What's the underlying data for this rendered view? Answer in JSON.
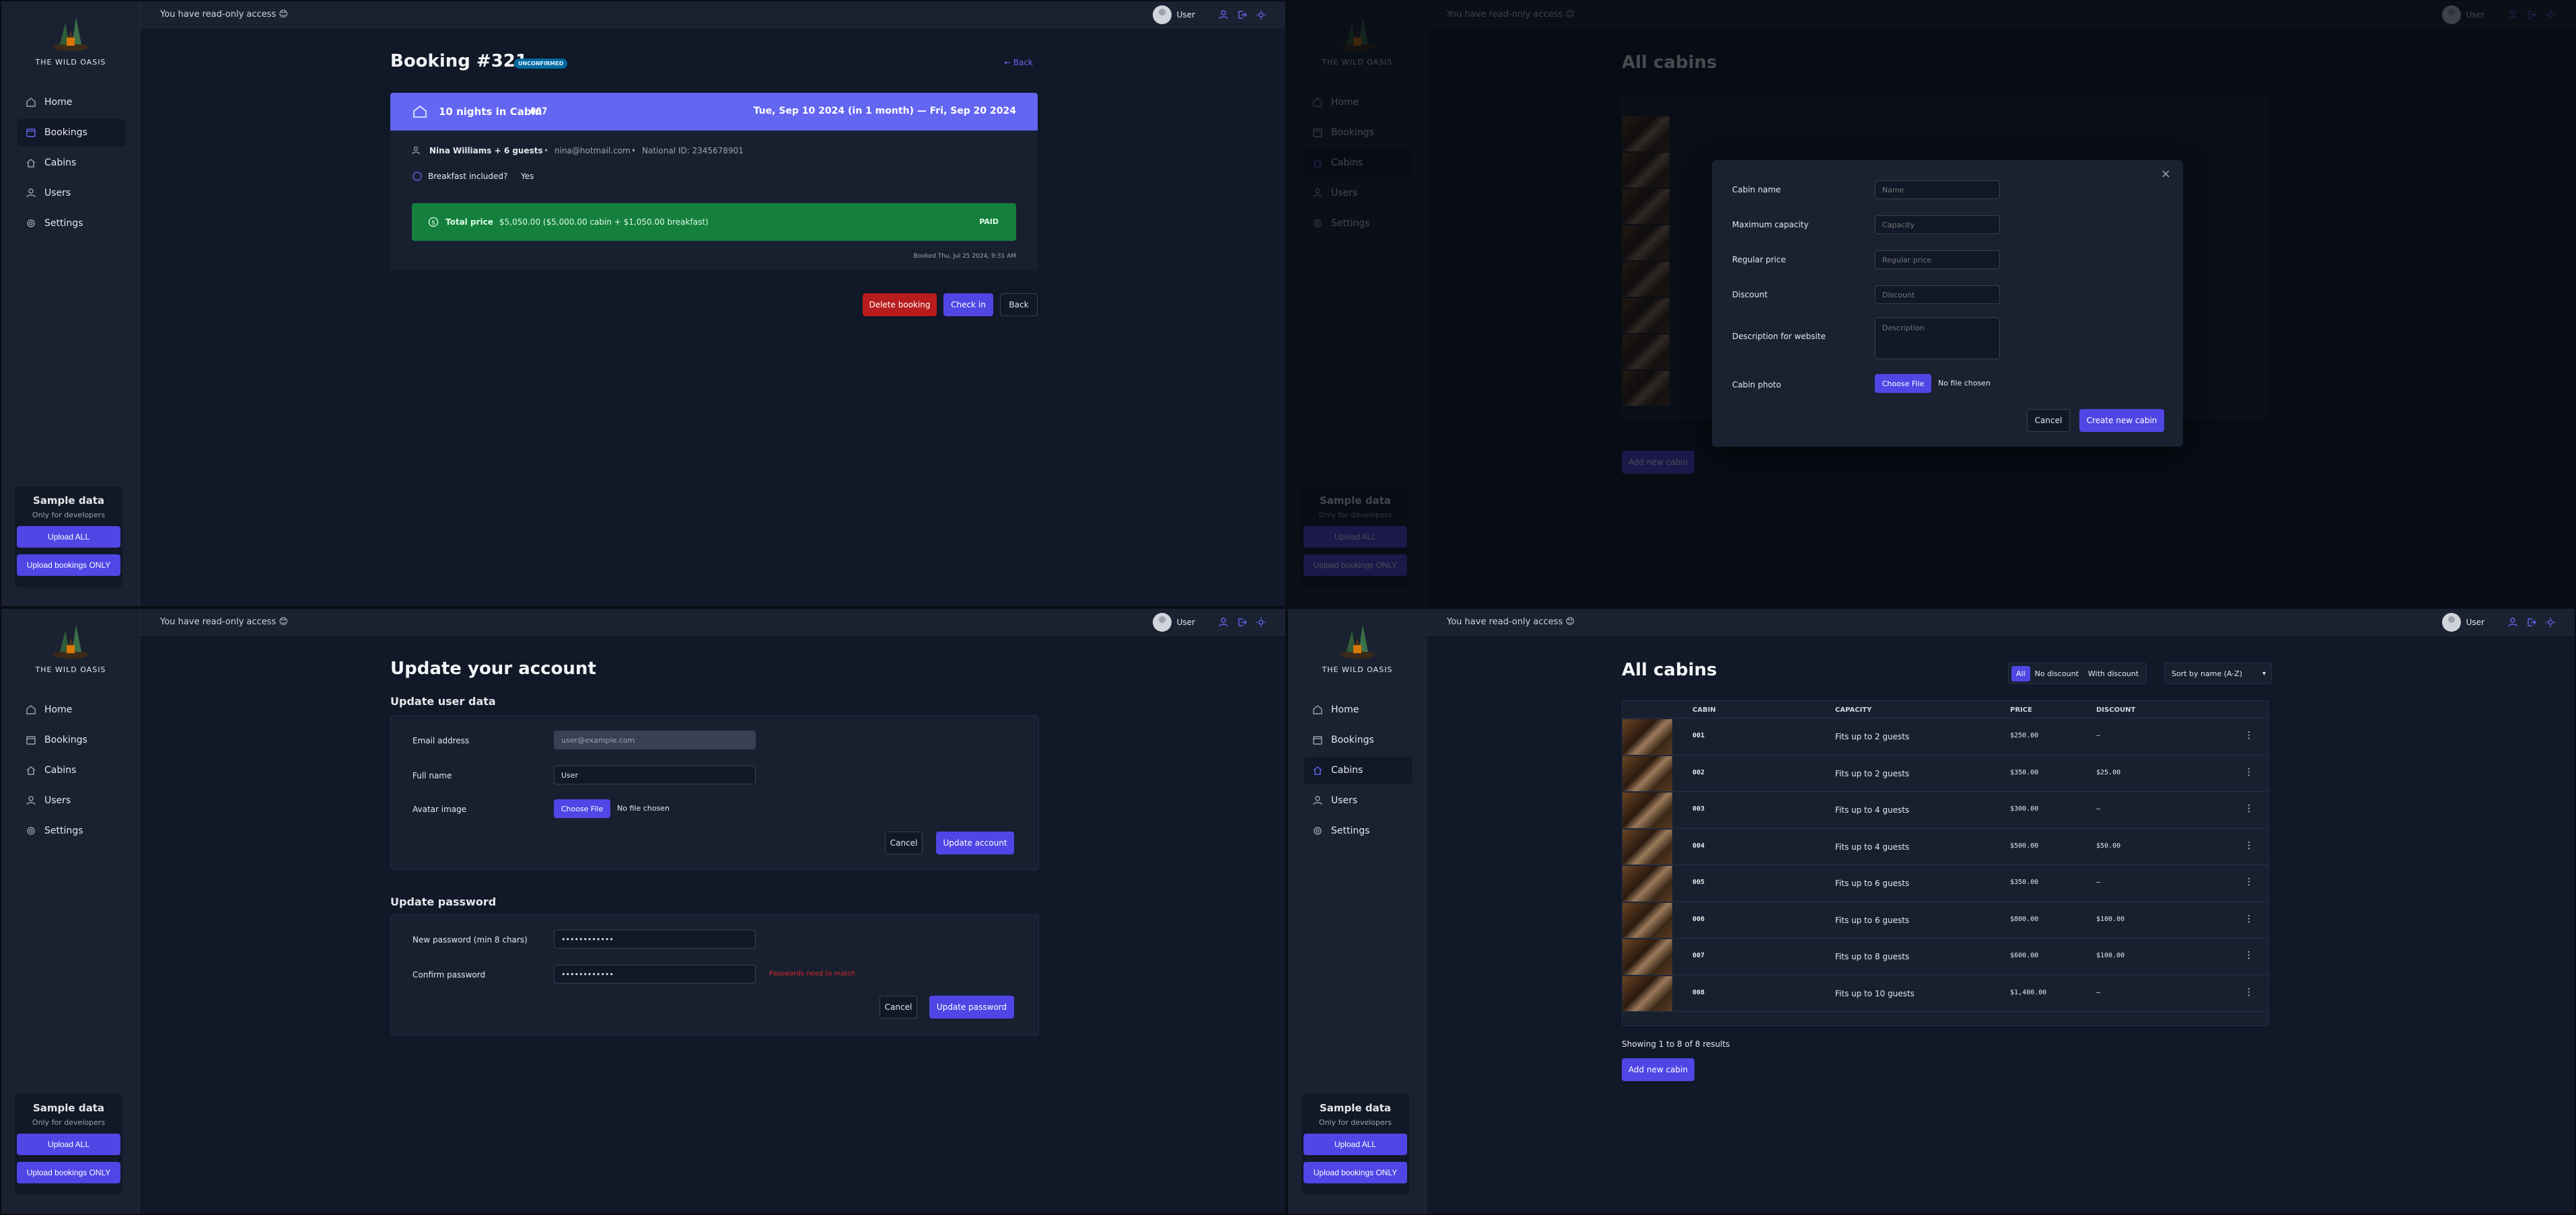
{
  "brand": {
    "name": "THE WILD OASIS"
  },
  "nav": {
    "home": "Home",
    "bookings": "Bookings",
    "cabins": "Cabins",
    "users": "Users",
    "settings": "Settings"
  },
  "sample": {
    "title": "Sample data",
    "subtitle": "Only for developers",
    "upload_all": "Upload ALL",
    "upload_bookings": "Upload bookings ONLY"
  },
  "topbar": {
    "read_only": "You have read-only access 😊",
    "user": "User"
  },
  "booking": {
    "title": "Booking #321",
    "status": "UNCONFIRMED",
    "back_link": "← Back",
    "header_nights": "10 nights in Cabin",
    "header_cabin": "007",
    "header_dates": "Tue, Sep 10 2024 (in 1 month) — Fri, Sep 20 2024",
    "guest": "Nina Williams + 6 guests",
    "dot": "•",
    "email": "nina@hotmail.com",
    "national_id": "National ID: 2345678901",
    "breakfast_label": "Breakfast included?",
    "breakfast_value": "Yes",
    "price_label": "Total price",
    "price_value": "$5,050.00 ($5,000.00 cabin + $1,050.00 breakfast)",
    "paid": "PAID",
    "booked_on": "Booked Thu, Jul 25 2024, 9:31 AM",
    "delete_btn": "Delete booking",
    "checkin_btn": "Check in",
    "back_btn": "Back"
  },
  "modal": {
    "cabin_name": "Cabin name",
    "cabin_name_ph": "Name",
    "max_capacity": "Maximum capacity",
    "max_capacity_ph": "Capacity",
    "regular_price": "Regular price",
    "regular_price_ph": "Regular price",
    "discount": "Discount",
    "discount_ph": "Discount",
    "description": "Description for website",
    "description_ph": "Description",
    "photo": "Cabin photo",
    "choose_file": "Choose File",
    "no_file": "No file chosen",
    "cancel": "Cancel",
    "create": "Create new cabin",
    "close": "×"
  },
  "account": {
    "title": "Update your account",
    "user_section": "Update user data",
    "email_label": "Email address",
    "email_value": "user@example.com",
    "name_label": "Full name",
    "name_value": "User",
    "avatar_label": "Avatar image",
    "choose_file": "Choose File",
    "no_file": "No file chosen",
    "cancel": "Cancel",
    "update_account": "Update account",
    "pw_section": "Update password",
    "new_pw_label": "New password (min 8 chars)",
    "new_pw_value": "••••••••••••",
    "confirm_pw_label": "Confirm password",
    "confirm_pw_value": "••••••••••••",
    "pw_error": "Passwords need to match",
    "update_password": "Update password"
  },
  "cabins": {
    "title": "All cabins",
    "filters": [
      "All",
      "No discount",
      "With discount"
    ],
    "sort": "Sort by name (A-Z)",
    "headers": [
      "CABIN",
      "CAPACITY",
      "PRICE",
      "DISCOUNT"
    ],
    "rows": [
      {
        "name": "001",
        "capacity": "Fits up to 2 guests",
        "price": "$250.00",
        "discount": "—"
      },
      {
        "name": "002",
        "capacity": "Fits up to 2 guests",
        "price": "$350.00",
        "discount": "$25.00"
      },
      {
        "name": "003",
        "capacity": "Fits up to 4 guests",
        "price": "$300.00",
        "discount": "—"
      },
      {
        "name": "004",
        "capacity": "Fits up to 4 guests",
        "price": "$500.00",
        "discount": "$50.00"
      },
      {
        "name": "005",
        "capacity": "Fits up to 6 guests",
        "price": "$350.00",
        "discount": "—"
      },
      {
        "name": "006",
        "capacity": "Fits up to 6 guests",
        "price": "$800.00",
        "discount": "$100.00"
      },
      {
        "name": "007",
        "capacity": "Fits up to 8 guests",
        "price": "$600.00",
        "discount": "$100.00"
      },
      {
        "name": "008",
        "capacity": "Fits up to 10 guests",
        "price": "$1,400.00",
        "discount": "—"
      }
    ],
    "row_menu": "⋮",
    "showing": "Showing 1 to 8 of 8 results",
    "add": "Add new cabin"
  },
  "colors": {
    "accent": "#4f46e5",
    "header_band": "#6366f1",
    "paid": "#15803d",
    "danger": "#b91c1c",
    "bg": "#111827"
  }
}
